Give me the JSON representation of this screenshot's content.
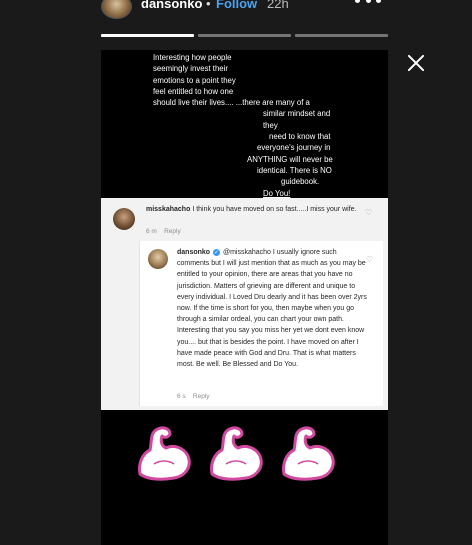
{
  "header": {
    "username": "dansonko",
    "separator": "•",
    "follow_label": "Follow",
    "time": "22h"
  },
  "progress": {
    "segments_total": 3,
    "current_segment": 1
  },
  "story": {
    "quote_lines": [
      "Interesting how people",
      "seemingly invest their",
      "emotions to a point they",
      "feel entitled to how one",
      "should live their lives.... ...there are many of a",
      "similar mindset and they",
      "need to know that",
      "everyone's journey in",
      "ANYTHING will never be",
      "identical. There is NO",
      "guidebook.",
      "Do You! #SipsPorridge"
    ],
    "comment": {
      "user": "misskahacho",
      "text": "I think you have moved on so fast.....I miss your wife.",
      "age": "6 m",
      "reply_label": "Reply"
    },
    "reply": {
      "user": "dansonko",
      "mention": "@misskahacho",
      "text": "I usually ignore such comments but I will just mention that as much as you may be entitled to your opinion, there are areas that you have no jurisdiction. Matters of grieving are different and unique to every individual. I Loved Dru dearly and it has been over 2yrs now. If the time is short for you, then maybe when you go through a similar ordeal, you can chart your own path. Interesting that you say you miss her yet we dont even know you.... but that is besides the point. I have moved on after I have made peace with God and Dru. That is what matters most. Be well. Be Blessed and Do You.",
      "age": "6 s",
      "reply_label": "Reply"
    },
    "emojis": [
      "flexed-biceps",
      "flexed-biceps",
      "flexed-biceps"
    ]
  },
  "colors": {
    "follow": "#4aa3f0",
    "background": "#1a1a1a"
  }
}
